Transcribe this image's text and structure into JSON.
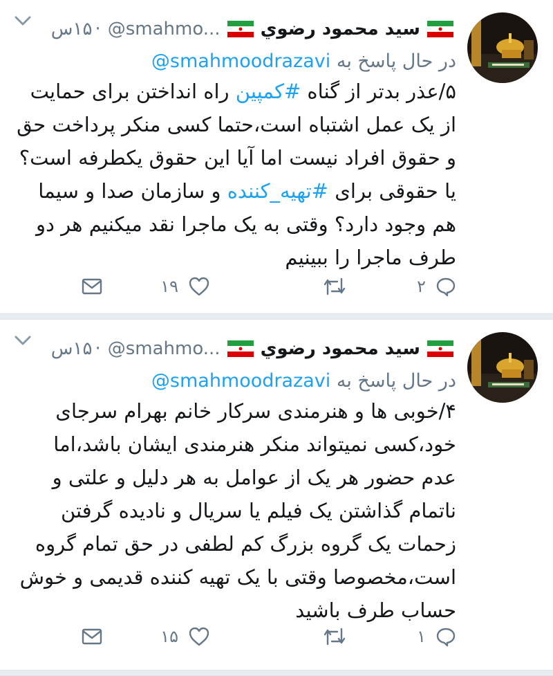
{
  "tweets": [
    {
      "display_name": "سید محمود رضوي",
      "handle": "@smahmo...",
      "dot": "·",
      "time": "۱۵س",
      "reply_prefix": "در حال پاسخ به",
      "reply_handle": "@smahmoodrazavi",
      "text_parts": [
        "۵/عذر بدتر از گناه ",
        "#کمپین",
        " راه انداختن برای حمایت از یک عمل اشتباه است،حتما کسی منکر پرداخت حق و حقوق افراد نیست اما آیا این حقوق یکطرفه است؟یا حقوقی برای ",
        "#تهیه_کننده",
        " و سازمان صدا و سیما هم وجود دارد؟ وقتی به یک ماجرا نقد میکنیم هر دو طرف ماجرا را ببینیم"
      ],
      "reply_count": "۲",
      "like_count": "۱۹"
    },
    {
      "display_name": "سید محمود رضوي",
      "handle": "@smahmo...",
      "dot": "·",
      "time": "۱۵س",
      "reply_prefix": "در حال پاسخ به",
      "reply_handle": "@smahmoodrazavi",
      "text": "۴/خوبی ها و هنرمندی سرکار خانم بهرام سرجای خود،کسی نمیتواند منکر هنرمندی ایشان باشد،اما عدم حضور هر یک از عوامل به هر دلیل و علتی و ناتمام گذاشتن یک فیلم یا سریال و نادیده گرفتن زحمات یک گروه بزرگ کم لطفی در حق تمام گروه است،مخصوصا وقتی با یک تهیه کننده قدیمی و خوش حساب طرف باشید",
      "reply_count": "۱",
      "like_count": "۱۵"
    }
  ],
  "icons": {
    "flag": "iran-flag-icon",
    "reply": "reply-icon",
    "retweet": "retweet-icon",
    "like": "heart-icon",
    "dm": "envelope-icon",
    "menu": "chevron-down-icon"
  },
  "colors": {
    "link": "#1da1f2",
    "secondary": "#657786",
    "separator": "#e6ecf0"
  }
}
